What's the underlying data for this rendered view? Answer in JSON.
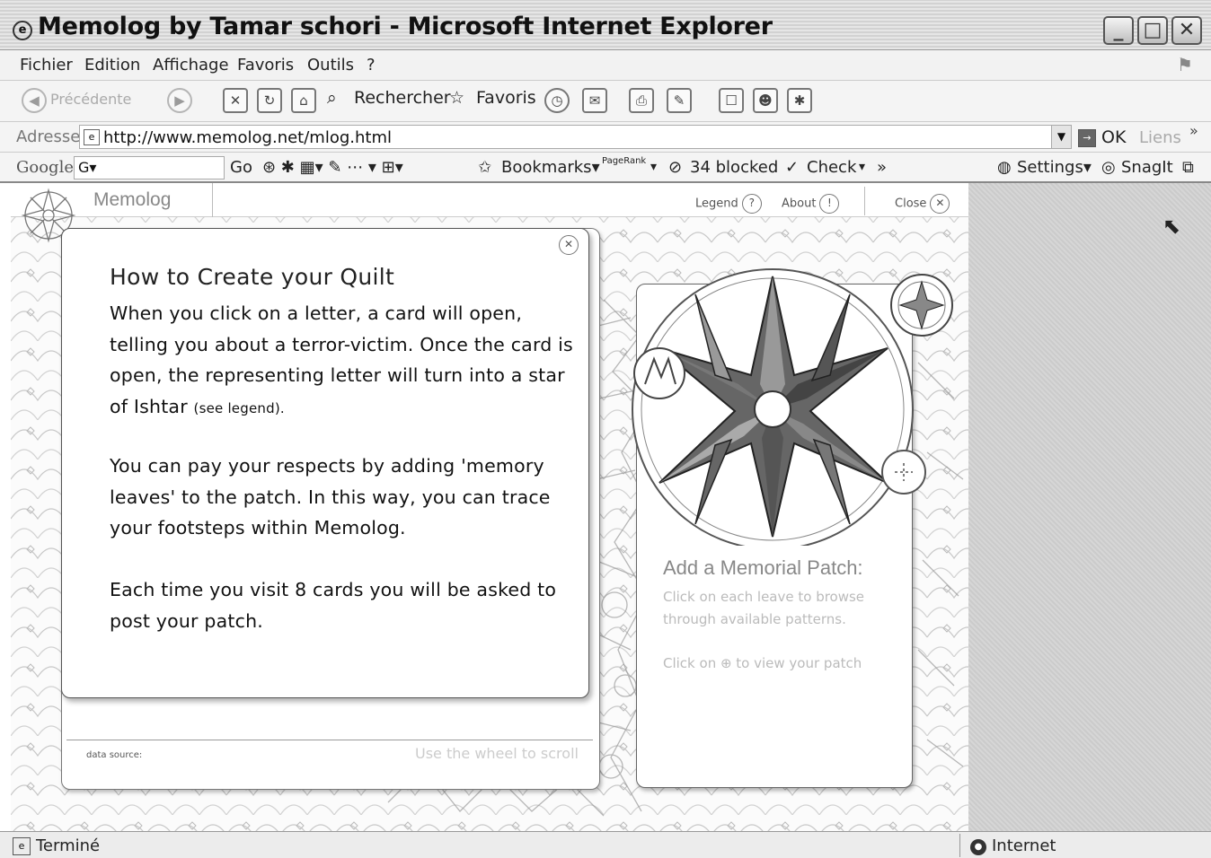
{
  "window": {
    "title": "Memolog by Tamar schori - Microsoft Internet Explorer",
    "minimize": "_",
    "maximize": "□",
    "close": "✕"
  },
  "menu": [
    "Fichier",
    "Edition",
    "Affichage",
    "Favoris",
    "Outils",
    "?"
  ],
  "toolbar": {
    "back": "Précédente",
    "search": "Rechercher",
    "favorites": "Favoris"
  },
  "address": {
    "label": "Adresse",
    "url": "http://www.memolog.net/mlog.html",
    "go": "OK",
    "links": "Liens",
    "more": "»"
  },
  "google_bar": {
    "label": "Google",
    "field": "G▾",
    "go": "Go",
    "bookmarks": "Bookmarks▾",
    "pagerank": "PageRank",
    "blocked": "34 blocked",
    "check": "Check",
    "more": "»",
    "settings": "Settings▾",
    "snagit": "SnagIt"
  },
  "app": {
    "title": "Memolog",
    "legend": "Legend",
    "legend_icon": "?",
    "about": "About",
    "about_icon": "!",
    "close": "Close",
    "close_icon": "✕"
  },
  "card": {
    "close_icon": "✕",
    "title": "How to Create your Quilt",
    "p1": "When you click on a letter, a card will open, telling you about a terror-victim. Once the card is open, the representing letter will turn into a star of Ishtar",
    "p1_small": "(see legend).",
    "p2": "You can pay your respects by adding  'memory leaves' to the patch. In this way, you can trace your footsteps within Memolog.",
    "p3": "Each time you visit 8 cards you will be asked to post your patch.",
    "data_source": "data source:",
    "scroll_hint": "Use the wheel to scroll"
  },
  "patch": {
    "title": "Add a Memorial Patch:",
    "line1": "Click on each leave to browse",
    "line2": "through available patterns.",
    "line3": "Click on ⊕ to view  your patch"
  },
  "status": {
    "text": "Terminé",
    "zone": "Internet"
  }
}
